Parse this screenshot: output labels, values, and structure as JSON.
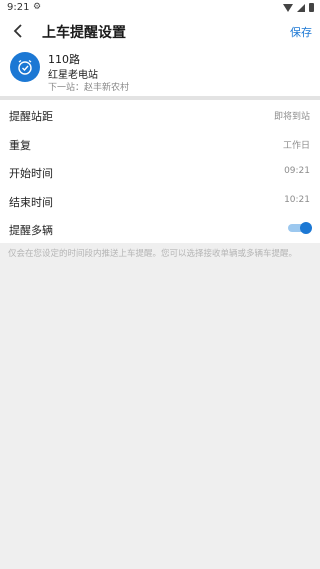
{
  "status_bar": {
    "time": "9:21"
  },
  "header": {
    "title": "上车提醒设置",
    "save_label": "保存"
  },
  "route": {
    "name": "110路",
    "station": "红星老电站",
    "next_stop": "下一站：赵丰新农村"
  },
  "settings": [
    {
      "label": "提醒站距",
      "value": "即将到站"
    },
    {
      "label": "重复",
      "value": "工作日"
    },
    {
      "label": "开始时间",
      "value": "09:21"
    },
    {
      "label": "结束时间",
      "value": "10:21"
    },
    {
      "label": "提醒多辆",
      "toggle": true
    }
  ],
  "footnote": "仅会在您设定的时间段内推送上车提醒。您可以选择接收单辆或多辆车提醒。",
  "colors": {
    "accent": "#1c78d4",
    "background": "#efefef"
  },
  "icons": [
    "back-arrow-icon",
    "alarm-clock-icon",
    "wifi-icon",
    "signal-icon",
    "battery-icon",
    "toggle-switch"
  ]
}
